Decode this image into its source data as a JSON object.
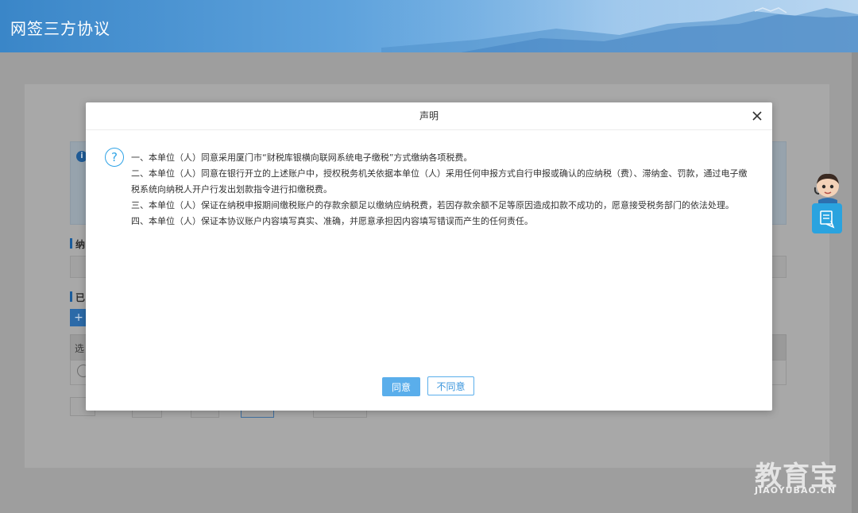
{
  "header": {
    "title": "网签三方协议"
  },
  "background": {
    "section1_label": "纳",
    "section2_label": "已",
    "plus_label": "+",
    "table_head_label": "选"
  },
  "modal": {
    "title": "声明",
    "close_icon": "close-icon",
    "clauses": [
      "一、本单位（人）同意采用厦门市“财税库银横向联网系统电子缴税”方式缴纳各项税费。",
      "二、本单位（人）同意在银行开立的上述账户中，授权税务机关依据本单位（人）采用任何申报方式自行申报或确认的应纳税（费）、滞纳金、罚款，通过电子缴税系统向纳税人开户行发出划款指令进行扣缴税费。",
      "三、本单位（人）保证在纳税申报期间缴税账户的存款余额足以缴纳应纳税费，若因存款余额不足等原因造成扣款不成功的，愿意接受税务部门的依法处理。",
      "四、本单位（人）保证本协议账户内容填写真实、准确，并愿意承担因内容填写错误而产生的任何责任。"
    ],
    "agree_label": "同意",
    "disagree_label": "不同意"
  },
  "watermark": {
    "text": "教育宝",
    "sub": "JIAOYUBAO.CN"
  },
  "colors": {
    "accent": "#2fa3e6",
    "header_blue": "#3a86c8",
    "agree_button": "#5aaeeb"
  }
}
